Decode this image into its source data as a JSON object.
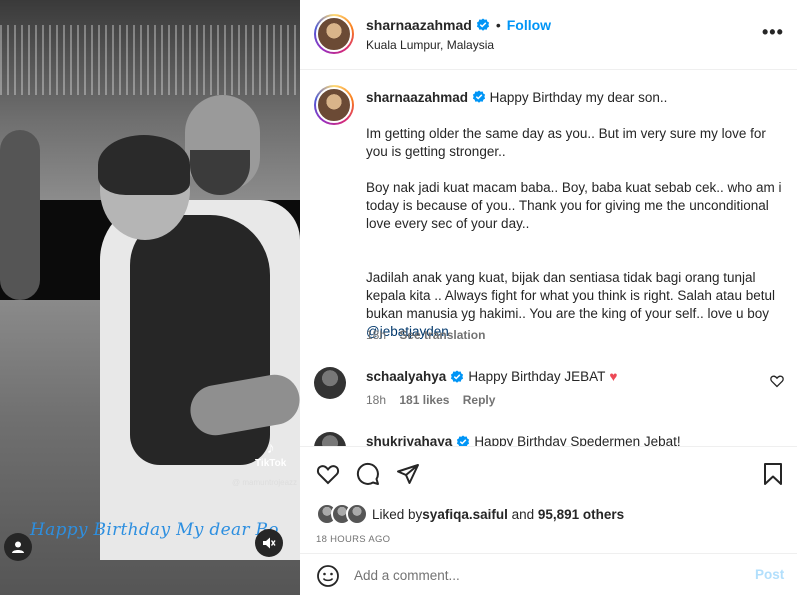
{
  "media": {
    "overlay_caption": "Happy Birthday My dear Bo",
    "watermark_brand": "TikTok",
    "watermark_handle": "@ mamuntrojeazz",
    "icons": [
      "user-tag-icon",
      "mute-icon",
      "tiktok-logo-icon"
    ]
  },
  "header": {
    "username": "sharnaazahmad",
    "separator": "•",
    "follow_label": "Follow",
    "location": "Kuala Lumpur, Malaysia",
    "more_label": "•••"
  },
  "caption": {
    "username": "sharnaazahmad",
    "first_line": "Happy Birthday my dear son..",
    "para1": "Im getting older the same day as you.. But im very sure my love for you is getting stronger..",
    "para2": "Boy nak jadi kuat macam baba.. Boy, baba kuat sebab cek.. who am i today is because of you.. Thank you for giving me the unconditional love every sec of your day..",
    "para3_text": "Jadilah anak yang kuat, bijak dan sentiasa tidak bagi orang tunjal kepala kita .. Always fight for what you think is right. Salah atau betul bukan manusia yg hakimi.. You are the king of your self.. love u boy ",
    "mention": "@jebatjayden",
    "time": "18h",
    "see_translation": "See translation"
  },
  "comments": [
    {
      "username": "schaalyahya",
      "text": "Happy Birthday JEBAT",
      "emoji": "♥",
      "time": "18h",
      "likes": "181 likes",
      "reply": "Reply"
    },
    {
      "username": "shukriyahaya",
      "text": "Happy Birthday Spedermen Jebat!"
    }
  ],
  "likes": {
    "prefix": "Liked by ",
    "user": "syafiqa.saiful",
    "and": " and ",
    "others": "95,891 others"
  },
  "date": "18 HOURS AGO",
  "add_comment": {
    "placeholder": "Add a comment...",
    "post_label": "Post"
  },
  "colors": {
    "verified_blue": "#0095f6",
    "follow_blue": "#0095f6",
    "heart_red": "#ed4956",
    "overlay_text_blue": "#2d8fe0",
    "post_disabled": "#b2dffc"
  }
}
